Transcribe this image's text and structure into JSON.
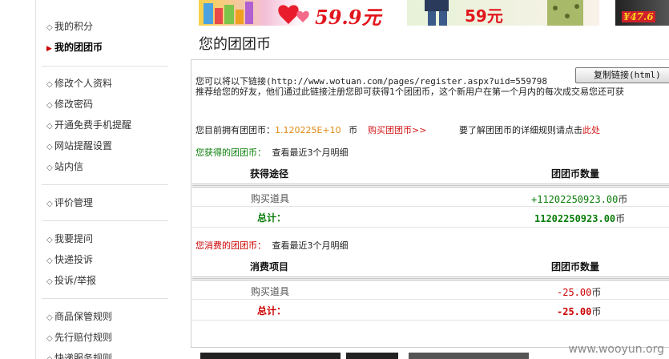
{
  "sidebar": {
    "groups": [
      [
        {
          "label": "我的积分",
          "active": false
        },
        {
          "label": "我的团团币",
          "active": true
        }
      ],
      [
        {
          "label": "修改个人资料",
          "active": false
        },
        {
          "label": "修改密码",
          "active": false
        },
        {
          "label": "开通免费手机提醒",
          "active": false
        },
        {
          "label": "网站提醒设置",
          "active": false
        },
        {
          "label": "站内信",
          "active": false
        }
      ],
      [
        {
          "label": "评价管理",
          "active": false
        }
      ],
      [
        {
          "label": "我要提问",
          "active": false
        },
        {
          "label": "快递投诉",
          "active": false
        },
        {
          "label": "投诉/举报",
          "active": false
        }
      ],
      [
        {
          "label": "商品保管规则",
          "active": false
        },
        {
          "label": "先行赔付规则",
          "active": false
        },
        {
          "label": "快递服务规则",
          "active": false
        }
      ]
    ]
  },
  "banner": {
    "items": [
      {
        "price": "59.9元"
      },
      {
        "price": "59元"
      },
      {
        "price": "¥47.6"
      }
    ]
  },
  "page": {
    "title": "您的团团币"
  },
  "referral": {
    "intro_prefix": "您可以将以下链接(",
    "url": "http://www.wotuan.com/pages/register.aspx?uid=559798",
    "copy_button": "复制链接(html)",
    "desc": "推荐给您的好友，他们通过此链接注册您即可获得1个团团币，这个新用户在第一个月内的每次成交易您还可获"
  },
  "balance": {
    "label": "您目前拥有团团币：",
    "value": "1.120225E+10",
    "unit": "币",
    "buy_link": "购买团团币>>",
    "rules_text": "要了解团团币的详细规则请点击",
    "rules_link": "此处"
  },
  "earned": {
    "title": "您获得的团团币：",
    "subtitle": "查看最近3个月明细",
    "col_source": "获得途径",
    "col_amount": "团团币数量",
    "rows": [
      {
        "source": "购买道具",
        "amount": "+11202250923.00",
        "unit": "币"
      }
    ],
    "total_label": "总计：",
    "total_amount": "11202250923.00",
    "total_unit": "币"
  },
  "spent": {
    "title": "您消费的团团币：",
    "subtitle": "查看最近3个月明细",
    "col_item": "消费项目",
    "col_amount": "团团币数量",
    "rows": [
      {
        "item": "购买道具",
        "amount": "-25.00",
        "unit": "币"
      }
    ],
    "total_label": "总计：",
    "total_amount": "-25.00",
    "total_unit": "币"
  },
  "watermark": "www.wooyun.org",
  "colors": {
    "accent_red": "#c00000",
    "green": "#0a7d0a",
    "orange": "#e08a12"
  }
}
